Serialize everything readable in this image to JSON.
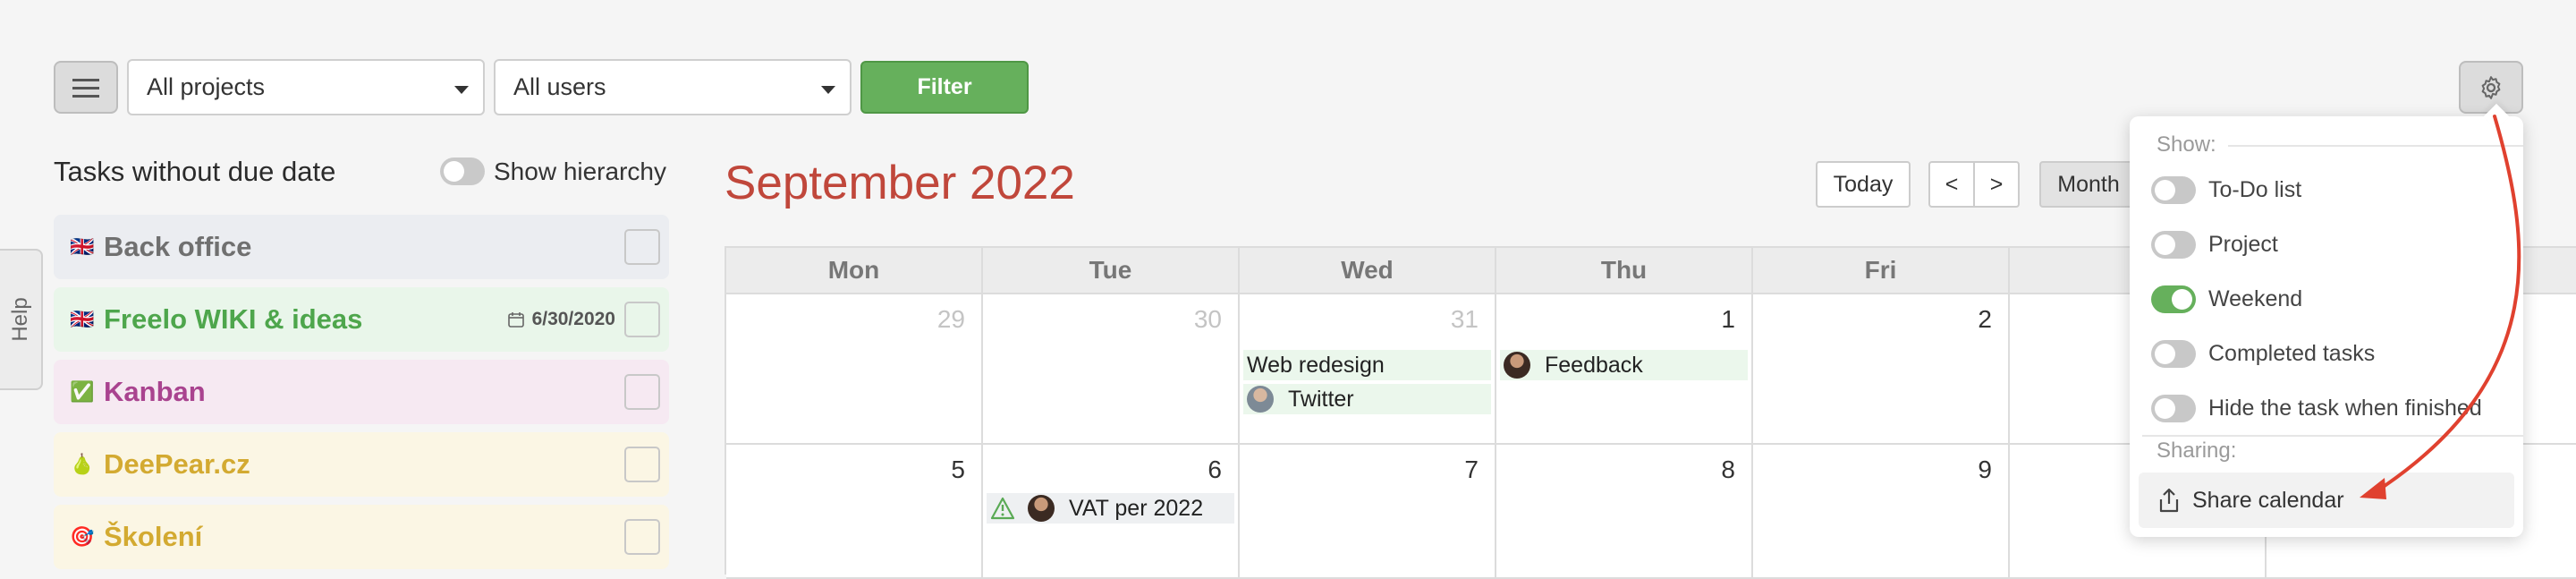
{
  "toolbar": {
    "menu_icon": "hamburger-icon",
    "project_select": "All projects",
    "user_select": "All users",
    "filter_label": "Filter",
    "settings_icon": "gear-icon"
  },
  "help": {
    "label": "Help"
  },
  "left_panel": {
    "title": "Tasks without due date",
    "hierarchy_label": "Show hierarchy",
    "hierarchy_on": false,
    "tasks": [
      {
        "icon": "🇬🇧",
        "name": "Back office",
        "color": "#707070",
        "bg": "#ebedf1",
        "date": ""
      },
      {
        "icon": "🇬🇧",
        "name": "Freelo WIKI & ideas",
        "color": "#4ea64c",
        "bg": "#e9f6ea",
        "date": "6/30/2020"
      },
      {
        "icon": "✅",
        "name": "Kanban",
        "color": "#a9438f",
        "bg": "#f6e9f2",
        "date": ""
      },
      {
        "icon": "🍐",
        "name": "DeePear.cz",
        "color": "#d3aa31",
        "bg": "#fbf6e4",
        "date": ""
      },
      {
        "icon": "🎯",
        "name": "Školení",
        "color": "#d3aa31",
        "bg": "#fbf6e4",
        "date": ""
      }
    ]
  },
  "calendar": {
    "title": "September 2022",
    "today_label": "Today",
    "prev_label": "<",
    "next_label": ">",
    "view_label": "Month",
    "weekdays": [
      "Mon",
      "Tue",
      "Wed",
      "Thu",
      "Fri",
      "S"
    ],
    "weeks": [
      [
        {
          "day": "29",
          "muted": true
        },
        {
          "day": "30",
          "muted": true
        },
        {
          "day": "31",
          "muted": true
        },
        {
          "day": "1",
          "muted": false
        },
        {
          "day": "2",
          "muted": false
        },
        {
          "day": "",
          "muted": false
        }
      ],
      [
        {
          "day": "5",
          "muted": false
        },
        {
          "day": "6",
          "muted": false
        },
        {
          "day": "7",
          "muted": false
        },
        {
          "day": "8",
          "muted": false
        },
        {
          "day": "9",
          "muted": false
        },
        {
          "day": "",
          "muted": false
        }
      ]
    ],
    "events": {
      "web_redesign": "Web redesign",
      "twitter": "Twitter",
      "feedback": "Feedback",
      "vat": "VAT per 2022"
    }
  },
  "settings_menu": {
    "show_header": "Show:",
    "options": [
      {
        "label": "To-Do list",
        "on": false
      },
      {
        "label": "Project",
        "on": false
      },
      {
        "label": "Weekend",
        "on": true
      },
      {
        "label": "Completed tasks",
        "on": false
      },
      {
        "label": "Hide the task when finished",
        "on": false
      }
    ],
    "sharing_header": "Sharing:",
    "share_label": "Share calendar"
  },
  "colors": {
    "accent_green": "#66b05c",
    "title_red": "#c0473b",
    "annotation_red": "#e0412f"
  }
}
